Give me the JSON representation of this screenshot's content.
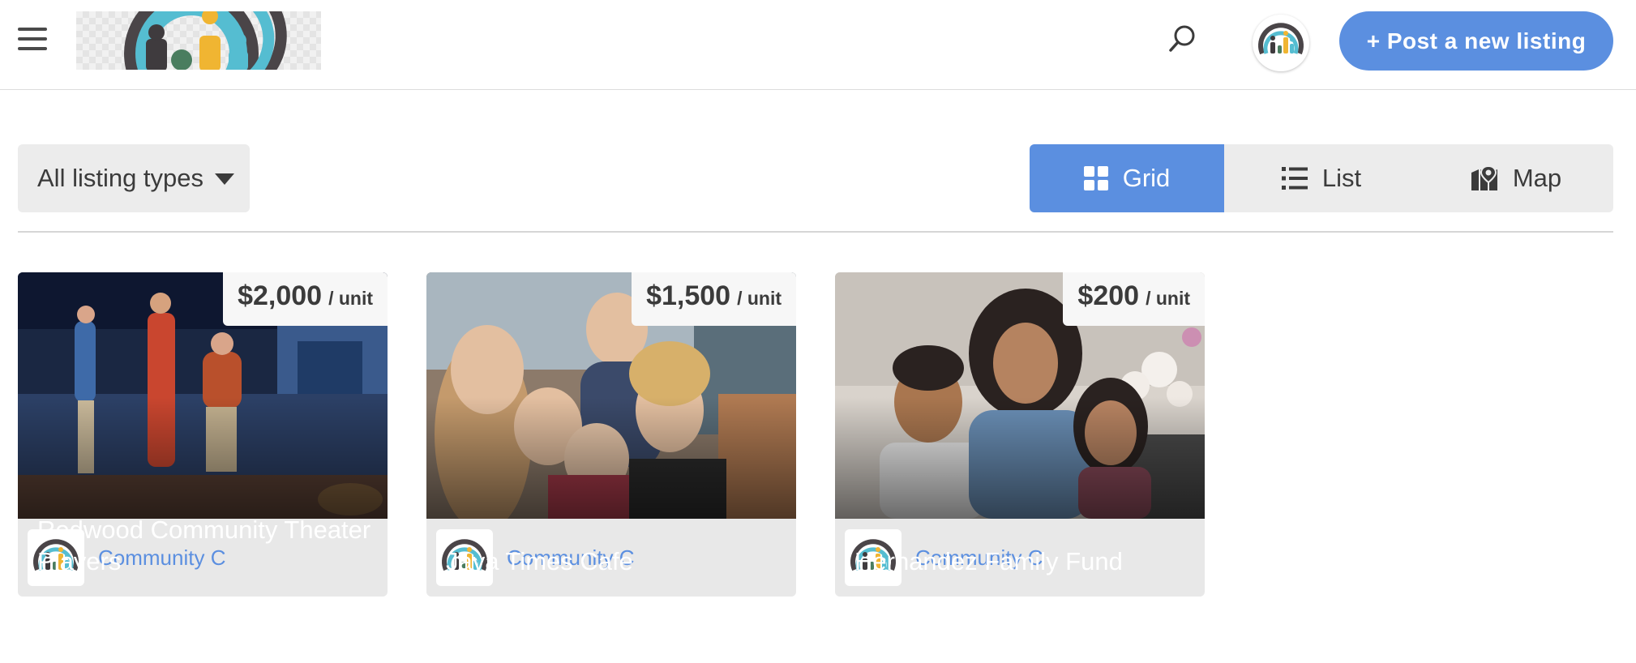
{
  "header": {
    "menu_icon": "hamburger-menu-icon",
    "logo_icon": "community-logo",
    "search_icon": "search-icon",
    "avatar_icon": "user-avatar",
    "post_button_label": "+ Post a new listing",
    "accent_color": "#5b8fe0"
  },
  "filters": {
    "listing_type_label": "All listing types",
    "listing_type_icon": "caret-down-icon",
    "views": [
      {
        "label": "Grid",
        "icon": "grid-icon",
        "active": true
      },
      {
        "label": "List",
        "icon": "list-icon",
        "active": false
      },
      {
        "label": "Map",
        "icon": "map-pin-icon",
        "active": false
      }
    ]
  },
  "listings": [
    {
      "title": "Redwood Community Theater Players",
      "price": "$2,000",
      "unit": "/ unit",
      "author": "Community C"
    },
    {
      "title": "Java Times Cafe",
      "price": "$1,500",
      "unit": "/ unit",
      "author": "Community C"
    },
    {
      "title": "Hernandez Family Fund",
      "price": "$200",
      "unit": "/ unit",
      "author": "Community C"
    }
  ]
}
